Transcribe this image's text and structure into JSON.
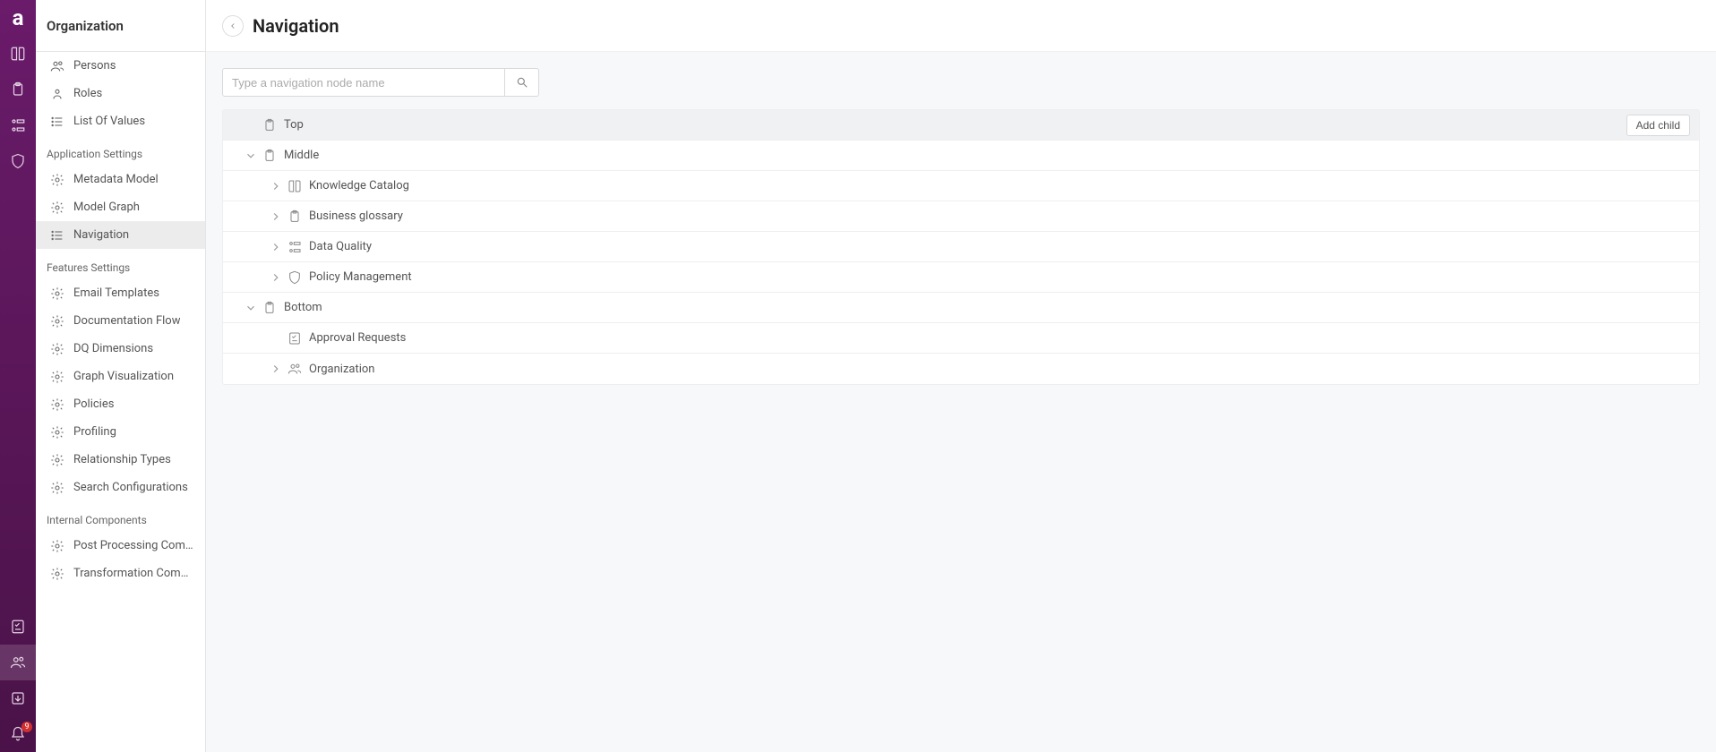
{
  "rail": {
    "notification_count": "9"
  },
  "sidebar": {
    "title": "Organization",
    "plain_items": [
      {
        "icon": "people",
        "label": "Persons"
      },
      {
        "icon": "role",
        "label": "Roles"
      },
      {
        "icon": "list",
        "label": "List Of Values"
      }
    ],
    "groups": [
      {
        "title": "Application Settings",
        "items": [
          {
            "icon": "gear",
            "label": "Metadata Model"
          },
          {
            "icon": "gear",
            "label": "Model Graph"
          },
          {
            "icon": "list",
            "label": "Navigation",
            "active": true
          }
        ]
      },
      {
        "title": "Features Settings",
        "items": [
          {
            "icon": "gear",
            "label": "Email Templates"
          },
          {
            "icon": "gear",
            "label": "Documentation Flow"
          },
          {
            "icon": "gear",
            "label": "DQ Dimensions"
          },
          {
            "icon": "gear",
            "label": "Graph Visualization"
          },
          {
            "icon": "gear",
            "label": "Policies"
          },
          {
            "icon": "gear",
            "label": "Profiling"
          },
          {
            "icon": "gear",
            "label": "Relationship Types"
          },
          {
            "icon": "gear",
            "label": "Search Configurations"
          }
        ]
      },
      {
        "title": "Internal Components",
        "items": [
          {
            "icon": "gear",
            "label": "Post Processing Compon…"
          },
          {
            "icon": "gear",
            "label": "Transformation Compon…"
          }
        ]
      }
    ]
  },
  "main": {
    "title": "Navigation",
    "search_placeholder": "Type a navigation node name",
    "add_child_label": "Add child",
    "tree": [
      {
        "depth": 0,
        "chev": "none",
        "icon": "clipboard",
        "label": "Top",
        "selected": true,
        "add": true
      },
      {
        "depth": 0,
        "chev": "down",
        "icon": "clipboard",
        "label": "Middle"
      },
      {
        "depth": 1,
        "chev": "right",
        "icon": "book",
        "label": "Knowledge Catalog"
      },
      {
        "depth": 1,
        "chev": "right",
        "icon": "clipboard",
        "label": "Business glossary"
      },
      {
        "depth": 1,
        "chev": "right",
        "icon": "quality",
        "label": "Data Quality"
      },
      {
        "depth": 1,
        "chev": "right",
        "icon": "shield",
        "label": "Policy Management"
      },
      {
        "depth": 0,
        "chev": "down",
        "icon": "clipboard",
        "label": "Bottom"
      },
      {
        "depth": 1,
        "chev": "none",
        "icon": "checklist",
        "label": "Approval Requests"
      },
      {
        "depth": 1,
        "chev": "right",
        "icon": "people",
        "label": "Organization"
      }
    ]
  }
}
